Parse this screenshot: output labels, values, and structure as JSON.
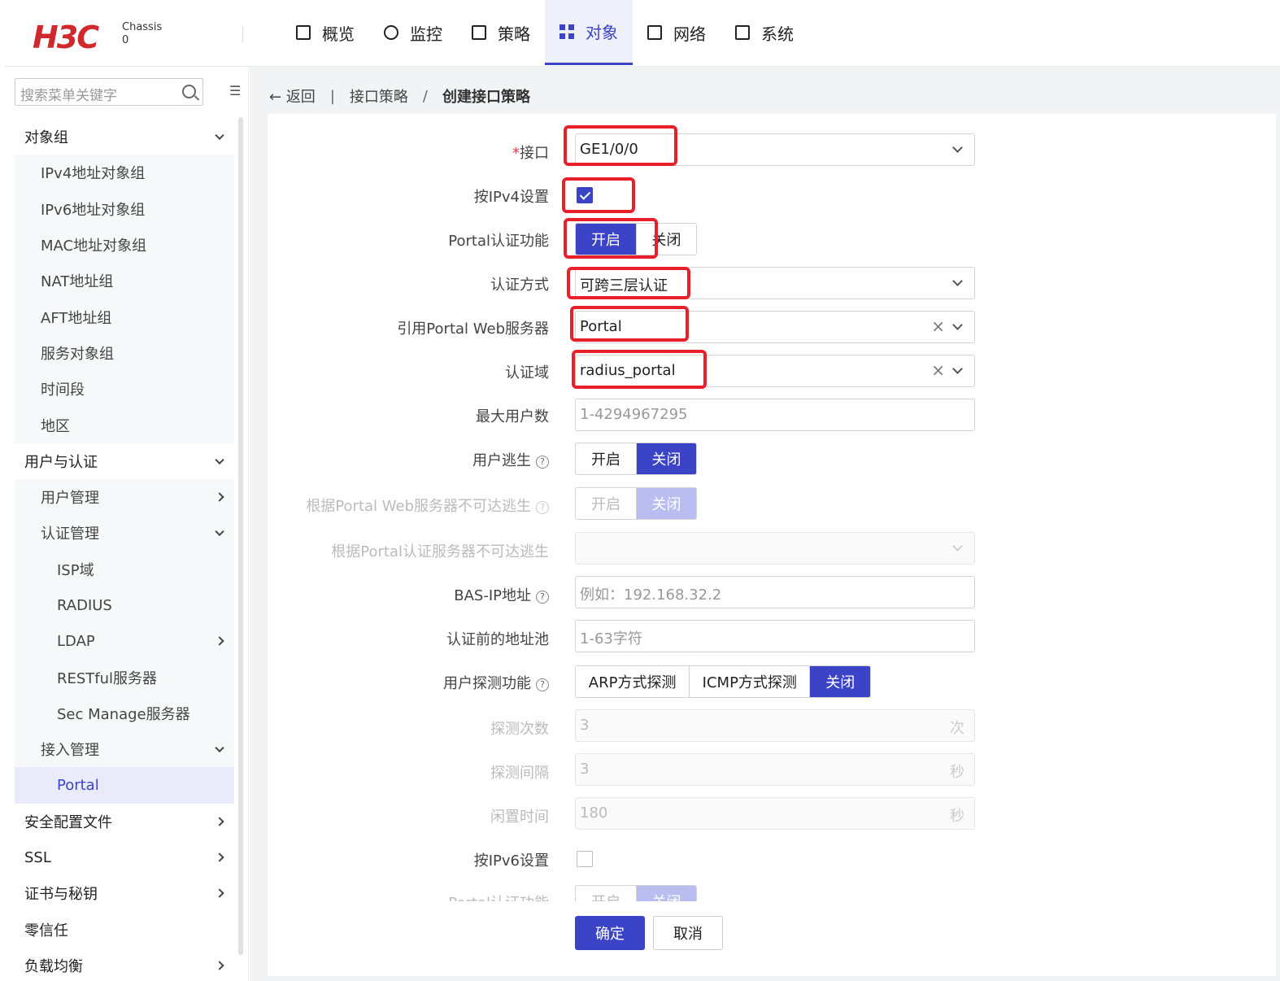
{
  "header": {
    "logo": "H3C",
    "chassis_label": "Chassis",
    "chassis_value": "0",
    "nav": [
      {
        "label": "概览",
        "icon": "monitor-icon"
      },
      {
        "label": "监控",
        "icon": "camera-icon"
      },
      {
        "label": "策略",
        "icon": "clipboard-icon"
      },
      {
        "label": "对象",
        "icon": "grid-icon",
        "active": true
      },
      {
        "label": "网络",
        "icon": "network-icon"
      },
      {
        "label": "系统",
        "icon": "system-icon"
      }
    ]
  },
  "sidebar": {
    "search_placeholder": "搜索菜单关键字",
    "items": [
      {
        "label": "对象组",
        "level": 0,
        "arrow": "down"
      },
      {
        "label": "IPv4地址对象组",
        "level": 1
      },
      {
        "label": "IPv6地址对象组",
        "level": 1
      },
      {
        "label": "MAC地址对象组",
        "level": 1
      },
      {
        "label": "NAT地址组",
        "level": 1
      },
      {
        "label": "AFT地址组",
        "level": 1
      },
      {
        "label": "服务对象组",
        "level": 1
      },
      {
        "label": "时间段",
        "level": 1
      },
      {
        "label": "地区",
        "level": 1
      },
      {
        "label": "用户与认证",
        "level": 0,
        "arrow": "down"
      },
      {
        "label": "用户管理",
        "level": 1,
        "arrow": "right"
      },
      {
        "label": "认证管理",
        "level": 1,
        "arrow": "down"
      },
      {
        "label": "ISP域",
        "level": 2
      },
      {
        "label": "RADIUS",
        "level": 2
      },
      {
        "label": "LDAP",
        "level": 2,
        "arrow": "right"
      },
      {
        "label": "RESTful服务器",
        "level": 2
      },
      {
        "label": "Sec Manage服务器",
        "level": 2
      },
      {
        "label": "接入管理",
        "level": 1,
        "arrow": "down"
      },
      {
        "label": "Portal",
        "level": 2,
        "selected": true
      },
      {
        "label": "安全配置文件",
        "level": 0,
        "arrow": "right"
      },
      {
        "label": "SSL",
        "level": 0,
        "arrow": "right"
      },
      {
        "label": "证书与秘钥",
        "level": 0,
        "arrow": "right"
      },
      {
        "label": "零信任",
        "level": 0
      },
      {
        "label": "负载均衡",
        "level": 0,
        "arrow": "right"
      }
    ]
  },
  "breadcrumb": {
    "back": "返回",
    "parent": "接口策略",
    "separator": "/",
    "current": "创建接口策略"
  },
  "form": {
    "interface_label": "接口",
    "interface_required": "*",
    "interface_value": "GE1/0/0",
    "ipv4_label": "按IPv4设置",
    "portal_label": "Portal认证功能",
    "on": "开启",
    "off": "关闭",
    "auth_method_label": "认证方式",
    "auth_method_value": "可跨三层认证",
    "web_server_label": "引用Portal Web服务器",
    "web_server_value": "Portal",
    "domain_label": "认证域",
    "domain_value": "radius_portal",
    "max_users_label": "最大用户数",
    "max_users_placeholder": "1-4294967295",
    "escape_label": "用户逃生",
    "web_escape_label": "根据Portal Web服务器不可达逃生",
    "auth_escape_label": "根据Portal认证服务器不可达逃生",
    "bas_ip_label": "BAS-IP地址",
    "bas_ip_placeholder": "例如：192.168.32.2",
    "pool_label": "认证前的地址池",
    "pool_placeholder": "1-63字符",
    "detect_label": "用户探测功能",
    "detect_arp": "ARP方式探测",
    "detect_icmp": "ICMP方式探测",
    "detect_count_label": "探测次数",
    "detect_count_value": "3",
    "detect_count_unit": "次",
    "detect_interval_label": "探测间隔",
    "detect_interval_value": "3",
    "detect_interval_unit": "秒",
    "idle_label": "闲置时间",
    "idle_value": "180",
    "idle_unit": "秒",
    "ipv6_label": "按IPv6设置",
    "help": "?",
    "clear": "×"
  },
  "buttons": {
    "ok": "确定",
    "cancel": "取消"
  },
  "colors": {
    "accent": "#3b43c7",
    "highlight": "#e8202a"
  }
}
